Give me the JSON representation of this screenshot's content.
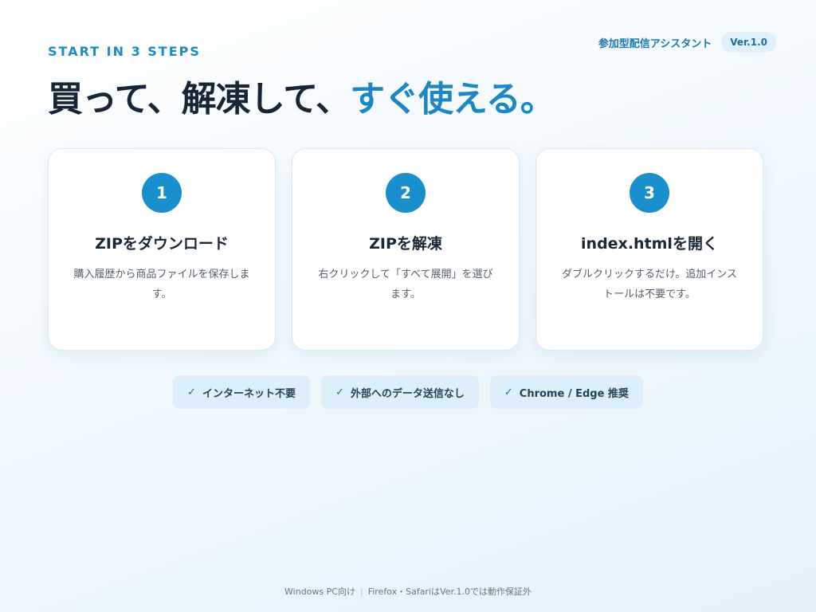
{
  "eyebrow": "START IN 3 STEPS",
  "headline": {
    "main": "買って、解凍して、",
    "accent": "すぐ使える。"
  },
  "app": {
    "name": "参加型配信アシスタント",
    "version": "Ver.1.0"
  },
  "steps": [
    {
      "number": "1",
      "title": "ZIPをダウンロード",
      "description": "購入履歴から商品ファイルを保存します。"
    },
    {
      "number": "2",
      "title": "ZIPを解凍",
      "description": "右クリックして「すべて展開」を選びます。"
    },
    {
      "number": "3",
      "title": "index.htmlを開く",
      "description": "ダブルクリックするだけ。追加インストールは不要です。"
    }
  ],
  "features": [
    {
      "icon": "check-icon",
      "label": "インターネット不要"
    },
    {
      "icon": "check-icon",
      "label": "外部へのデータ送信なし"
    },
    {
      "icon": "check-icon",
      "label": "Chrome / Edge 推奨"
    }
  ],
  "footer": {
    "left": "Windows PC向け",
    "right": "Firefox・SafariはVer.1.0では動作保証外"
  },
  "colors": {
    "accent": "#1a8fcd",
    "heading": "#172637",
    "feature_bg": "#dceffb"
  }
}
